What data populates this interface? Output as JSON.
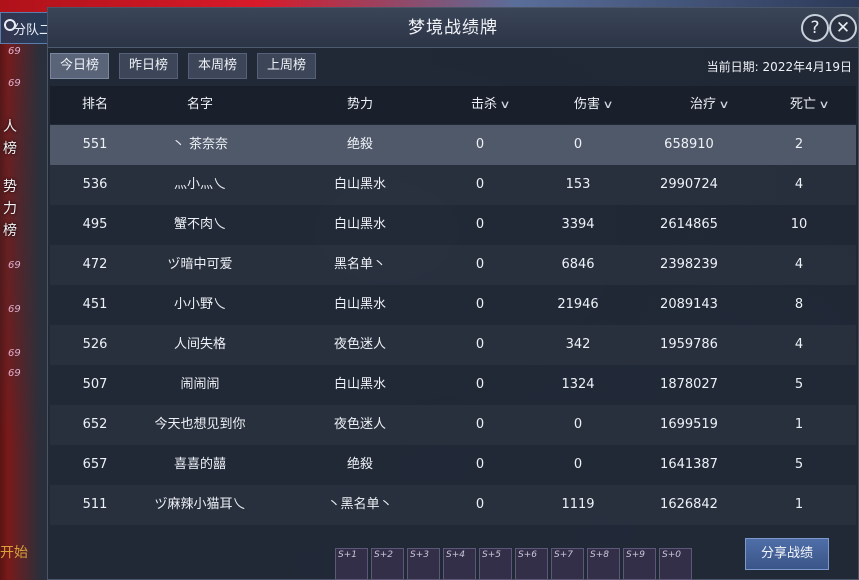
{
  "window": {
    "title": "梦境战绩牌"
  },
  "sidebar": {
    "team_tab": "分队二",
    "close": "✕",
    "levels": [
      "69",
      "69",
      "69",
      "69",
      "69",
      "69"
    ],
    "vertical_labels": [
      "人",
      "榜",
      "势",
      "力",
      "榜"
    ],
    "bottom_hint": "开始"
  },
  "tabs": [
    {
      "label": "今日榜",
      "active": true
    },
    {
      "label": "昨日榜",
      "active": false
    },
    {
      "label": "本周榜",
      "active": false
    },
    {
      "label": "上周榜",
      "active": false
    }
  ],
  "date": {
    "label": "当前日期:",
    "value": "2022年4月19日"
  },
  "columns": [
    {
      "key": "rank",
      "label": "排名",
      "sortable": false
    },
    {
      "key": "name",
      "label": "名字",
      "sortable": false
    },
    {
      "key": "faction",
      "label": "势力",
      "sortable": false
    },
    {
      "key": "kills",
      "label": "击杀",
      "sortable": true
    },
    {
      "key": "damage",
      "label": "伤害",
      "sortable": true
    },
    {
      "key": "heal",
      "label": "治疗",
      "sortable": true
    },
    {
      "key": "deaths",
      "label": "死亡",
      "sortable": true
    }
  ],
  "rows": [
    {
      "rank": "551",
      "name": "丶 茶奈奈",
      "faction": "绝殺",
      "kills": "0",
      "damage": "0",
      "heal": "658910",
      "deaths": "2",
      "selected": true
    },
    {
      "rank": "536",
      "name": "灬小灬乀",
      "faction": "白山黑水",
      "kills": "0",
      "damage": "153",
      "heal": "2990724",
      "deaths": "4"
    },
    {
      "rank": "495",
      "name": "蟹不肉乀",
      "faction": "白山黑水",
      "kills": "0",
      "damage": "3394",
      "heal": "2614865",
      "deaths": "10"
    },
    {
      "rank": "472",
      "name": "ヅ暗中可爱",
      "faction": "黑名单丶",
      "kills": "0",
      "damage": "6846",
      "heal": "2398239",
      "deaths": "4"
    },
    {
      "rank": "451",
      "name": "小小野乀",
      "faction": "白山黑水",
      "kills": "0",
      "damage": "21946",
      "heal": "2089143",
      "deaths": "8"
    },
    {
      "rank": "526",
      "name": "人间失格",
      "faction": "夜色迷人",
      "kills": "0",
      "damage": "342",
      "heal": "1959786",
      "deaths": "4"
    },
    {
      "rank": "507",
      "name": "闹闹闹",
      "faction": "白山黑水",
      "kills": "0",
      "damage": "1324",
      "heal": "1878027",
      "deaths": "5"
    },
    {
      "rank": "652",
      "name": "今天也想见到你",
      "faction": "夜色迷人",
      "kills": "0",
      "damage": "0",
      "heal": "1699519",
      "deaths": "1"
    },
    {
      "rank": "657",
      "name": "喜喜的囍",
      "faction": "绝殺",
      "kills": "0",
      "damage": "0",
      "heal": "1641387",
      "deaths": "5"
    },
    {
      "rank": "511",
      "name": "ヅ麻辣小猫耳乀",
      "faction": "丶黑名单丶",
      "kills": "0",
      "damage": "1119",
      "heal": "1626842",
      "deaths": "1"
    }
  ],
  "share_button": "分享战绩",
  "skills": [
    "S+1",
    "S+2",
    "S+3",
    "S+4",
    "S+5",
    "S+6",
    "S+7",
    "S+8",
    "S+9",
    "S+0"
  ],
  "icons": {
    "help": "?",
    "close": "✕",
    "sort": "chevron-down-icon"
  },
  "colors": {
    "panel": "#202836",
    "selected_row": "#787f96",
    "accent": "#4f6ea8"
  }
}
